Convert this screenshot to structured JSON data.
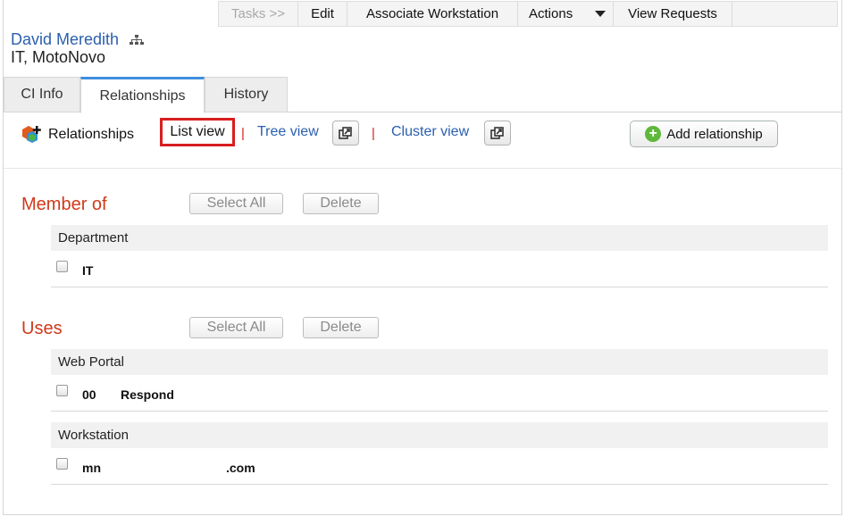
{
  "toolbar": {
    "tasks": "Tasks >>",
    "edit": "Edit",
    "associate": "Associate Workstation",
    "actions": "Actions",
    "view_requests": "View Requests"
  },
  "header": {
    "name": "David Meredith",
    "subtitle": "IT, MotoNovo"
  },
  "tabs": [
    "CI Info",
    "Relationships",
    "History"
  ],
  "relationships_bar": {
    "title": "Relationships",
    "list_view": "List view",
    "tree_view": "Tree view",
    "cluster_view": "Cluster view",
    "separator": "|",
    "add_relationship": "Add relationship"
  },
  "sections": [
    {
      "title": "Member of",
      "select_all": "Select All",
      "delete": "Delete",
      "groups": [
        {
          "header": "Department",
          "rows": [
            {
              "col1": "IT",
              "col2": ""
            }
          ]
        }
      ]
    },
    {
      "title": "Uses",
      "select_all": "Select All",
      "delete": "Delete",
      "groups": [
        {
          "header": "Web Portal",
          "rows": [
            {
              "col1": "00",
              "col2": "Respond"
            }
          ]
        },
        {
          "header": "Workstation",
          "rows": [
            {
              "col1": "mn",
              "col2": ".com"
            }
          ]
        }
      ]
    }
  ],
  "colors": {
    "link": "#2b5fad",
    "section_title": "#d0391a",
    "highlight": "#d81e1e",
    "active_tab_accent": "#3f8fdd"
  }
}
